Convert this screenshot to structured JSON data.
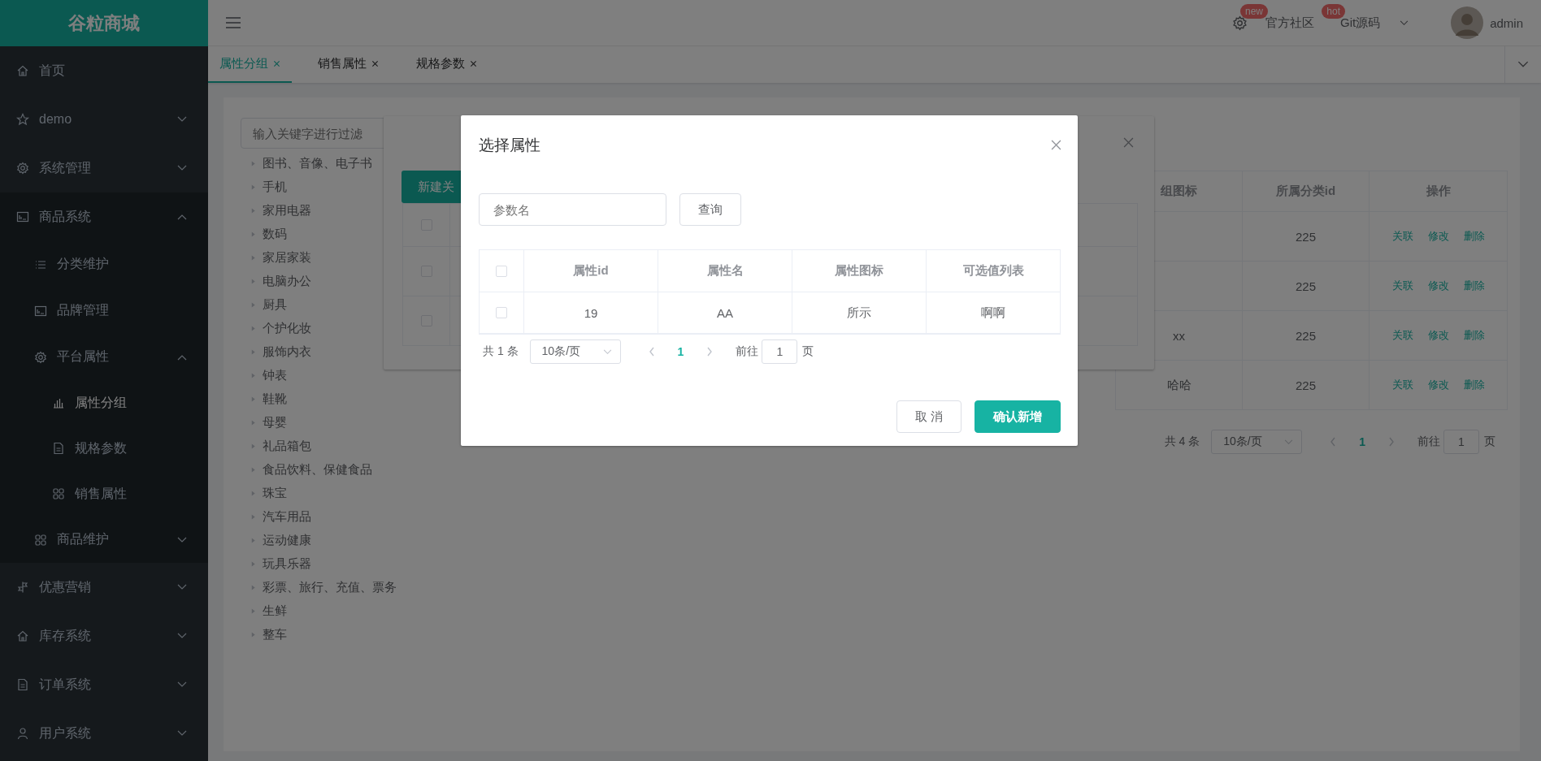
{
  "sidebar": {
    "logo": "谷粒商城",
    "items": [
      {
        "label": "首页",
        "selected": false
      },
      {
        "label": "demo",
        "expanded": false,
        "selected": false
      },
      {
        "label": "系统管理",
        "expanded": false,
        "selected": false
      },
      {
        "label": "商品系统",
        "expanded": true,
        "selected": false,
        "children": [
          {
            "label": "分类维护",
            "selected": false
          },
          {
            "label": "品牌管理",
            "selected": false
          },
          {
            "label": "平台属性",
            "expanded": true,
            "selected": false,
            "children": [
              {
                "label": "属性分组",
                "selected": true
              },
              {
                "label": "规格参数",
                "selected": false
              },
              {
                "label": "销售属性",
                "selected": false
              }
            ]
          },
          {
            "label": "商品维护",
            "expanded": false,
            "selected": false
          }
        ]
      },
      {
        "label": "优惠营销",
        "expanded": false,
        "selected": false
      },
      {
        "label": "库存系统",
        "expanded": false,
        "selected": false
      },
      {
        "label": "订单系统",
        "expanded": false,
        "selected": false
      },
      {
        "label": "用户系统",
        "expanded": false,
        "selected": false
      }
    ]
  },
  "header": {
    "notice_badge": "new",
    "community": {
      "label": "官方社区",
      "badge": "hot"
    },
    "git": "Git源码",
    "user": "admin"
  },
  "tabs": [
    {
      "label": "属性分组",
      "selected": true
    },
    {
      "label": "销售属性",
      "selected": false
    },
    {
      "label": "规格参数",
      "selected": false
    }
  ],
  "filter": {
    "placeholder": "输入关键字进行过滤"
  },
  "tree": [
    {
      "label": "图书、音像、电子书",
      "expanded": false
    },
    {
      "label": "手机",
      "expanded": false
    },
    {
      "label": "家用电器",
      "expanded": false
    },
    {
      "label": "数码",
      "expanded": false
    },
    {
      "label": "家居家装",
      "expanded": false
    },
    {
      "label": "电脑办公",
      "expanded": false
    },
    {
      "label": "厨具",
      "expanded": false
    },
    {
      "label": "个护化妆",
      "expanded": false
    },
    {
      "label": "服饰内衣",
      "expanded": false
    },
    {
      "label": "钟表",
      "expanded": false
    },
    {
      "label": "鞋靴",
      "expanded": false
    },
    {
      "label": "母婴",
      "expanded": false
    },
    {
      "label": "礼品箱包",
      "expanded": false
    },
    {
      "label": "食品饮料、保健食品",
      "expanded": false
    },
    {
      "label": "珠宝",
      "expanded": false
    },
    {
      "label": "汽车用品",
      "expanded": false
    },
    {
      "label": "运动健康",
      "expanded": false
    },
    {
      "label": "玩具乐器",
      "expanded": false
    },
    {
      "label": "彩票、旅行、充值、票务",
      "expanded": false
    },
    {
      "label": "生鲜",
      "expanded": false
    },
    {
      "label": "整车",
      "expanded": false
    }
  ],
  "group_table": {
    "columns": [
      "组图标",
      "所属分类id",
      "操作"
    ],
    "rows": [
      {
        "category_id": "225",
        "actions": [
          "关联",
          "修改",
          "删除"
        ]
      },
      {
        "category_id": "225",
        "actions": [
          "关联",
          "修改",
          "删除"
        ]
      },
      {
        "icon": "xx",
        "category_id": "225",
        "actions": [
          "关联",
          "修改",
          "删除"
        ]
      },
      {
        "icon": "哈哈",
        "category_id": "225",
        "actions": [
          "关联",
          "修改",
          "删除"
        ]
      }
    ],
    "pagination": {
      "total": "共 4 条",
      "page_size": "10条/页",
      "current": "1",
      "goto_label": "前往",
      "goto_value": "1",
      "page_suffix": "页"
    }
  },
  "relation_dialog": {
    "add_button": "新建关",
    "select_all": false,
    "rows": [
      {
        "checked": false
      },
      {
        "checked": false
      }
    ]
  },
  "modal": {
    "title": "选择属性",
    "search": {
      "placeholder": "参数名"
    },
    "query_button": "查询",
    "select_all": false,
    "columns": [
      "属性id",
      "属性名",
      "属性图标",
      "可选值列表"
    ],
    "rows": [
      {
        "checked": false,
        "cells": [
          "19",
          "AA",
          "所示",
          "啊啊"
        ]
      }
    ],
    "pagination": {
      "total": "共 1 条",
      "page_size": "10条/页",
      "current": "1",
      "goto_label": "前往",
      "goto_value": "1",
      "page_suffix": "页"
    },
    "buttons": [
      {
        "label": "取 消",
        "kind": "default"
      },
      {
        "label": "确认新增",
        "kind": "primary"
      }
    ]
  }
}
